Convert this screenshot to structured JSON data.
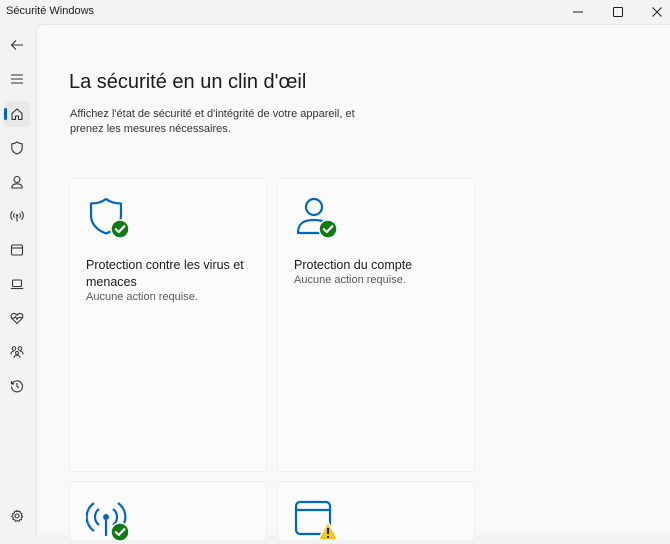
{
  "window": {
    "title": "Sécurité Windows",
    "controls": [
      "minimize",
      "maximize",
      "close"
    ]
  },
  "sidebar": {
    "items": [
      {
        "icon": "back-arrow-icon"
      },
      {
        "icon": "hamburger-menu-icon"
      },
      {
        "icon": "home-icon",
        "active": true
      },
      {
        "icon": "shield-icon"
      },
      {
        "icon": "person-icon"
      },
      {
        "icon": "wireless-icon"
      },
      {
        "icon": "browser-window-icon"
      },
      {
        "icon": "laptop-icon"
      },
      {
        "icon": "heart-pulse-icon"
      },
      {
        "icon": "family-icon"
      },
      {
        "icon": "history-icon"
      },
      {
        "icon": "settings-gear-icon"
      }
    ]
  },
  "main": {
    "title": "La sécurité en un clin d'œil",
    "subtitle": "Affichez l'état de sécurité et d'intégrité de votre appareil, et prenez les mesures nécessaires.",
    "cards": [
      {
        "title": "Protection contre les virus et menaces",
        "status": "Aucune action requise.",
        "icon": "shield-check-icon"
      },
      {
        "title": "Protection du compte",
        "status": "Aucune action requise.",
        "icon": "person-check-icon"
      },
      {
        "title": "",
        "status": "",
        "icon": "wireless-check-icon"
      },
      {
        "title": "",
        "status": "",
        "icon": "browser-warning-icon"
      }
    ]
  },
  "colors": {
    "accent": "#0067c0",
    "ok_green": "#107c10",
    "warning_yellow": "#f7c51b"
  }
}
